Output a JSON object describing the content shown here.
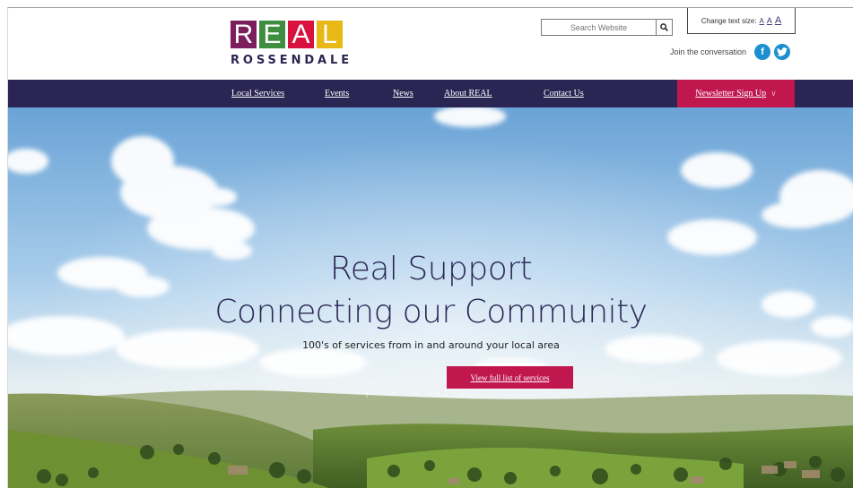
{
  "logo": {
    "letters": [
      "R",
      "E",
      "A",
      "L"
    ],
    "subtitle": "ROSSENDALE",
    "colors": [
      "#7b1f5d",
      "#3d8f3f",
      "#d8113f",
      "#e8b817"
    ]
  },
  "search": {
    "placeholder": "Search Website",
    "icon": "search-icon"
  },
  "text_size": {
    "label": "Change text size:",
    "options": [
      "A",
      "A",
      "A"
    ]
  },
  "social": {
    "label": "Join the conversation",
    "icons": [
      "facebook-icon",
      "twitter-icon"
    ],
    "color": "#1c8fd0"
  },
  "nav": {
    "items": [
      "Local Services",
      "Events",
      "News",
      "About REAL",
      "Contact Us"
    ],
    "newsletter": "Newsletter Sign Up",
    "newsletter_icon": "chevron-down-icon",
    "background": "#2a2553",
    "accent": "#c0174f"
  },
  "hero": {
    "title_line1": "Real Support",
    "title_line2": "Connecting our Community",
    "subtitle": "100's of services from in and around your local area",
    "cta": "View full list of services"
  }
}
